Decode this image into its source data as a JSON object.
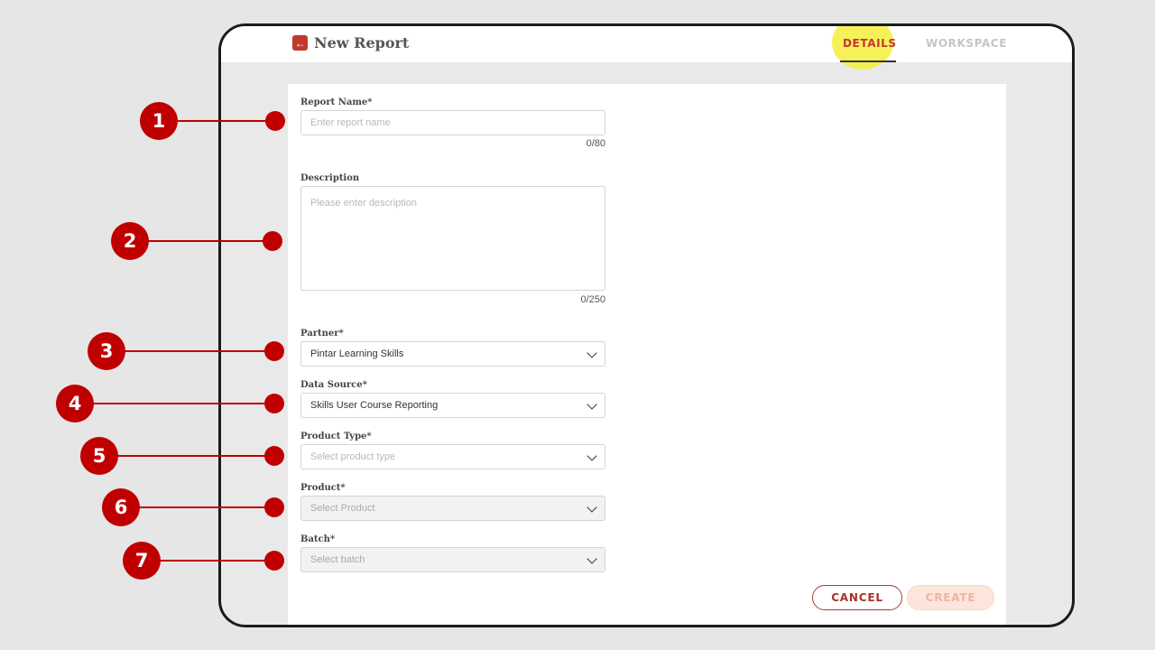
{
  "header": {
    "title": "New Report",
    "back_icon": "arrow-left-icon",
    "tabs": [
      {
        "label": "DETAILS",
        "active": true
      },
      {
        "label": "WORKSPACE",
        "active": false
      }
    ]
  },
  "form": {
    "report_name": {
      "label": "Report Name*",
      "placeholder": "Enter report name",
      "value": "",
      "counter": "0/80"
    },
    "description": {
      "label": "Description",
      "placeholder": "Please enter description",
      "value": "",
      "counter": "0/250"
    },
    "partner": {
      "label": "Partner*",
      "value": "Pintar Learning Skills"
    },
    "data_source": {
      "label": "Data Source*",
      "value": "Skills User Course Reporting"
    },
    "product_type": {
      "label": "Product Type*",
      "placeholder": "Select product type"
    },
    "product": {
      "label": "Product*",
      "placeholder": "Select Product",
      "disabled": true
    },
    "batch": {
      "label": "Batch*",
      "placeholder": "Select batch",
      "disabled": true
    }
  },
  "actions": {
    "cancel": "CANCEL",
    "create": "CREATE"
  },
  "callouts": [
    "1",
    "2",
    "3",
    "4",
    "5",
    "6",
    "7"
  ],
  "colors": {
    "accent": "#c0392b",
    "callout": "#c00000",
    "highlight": "#f5ef3c"
  }
}
